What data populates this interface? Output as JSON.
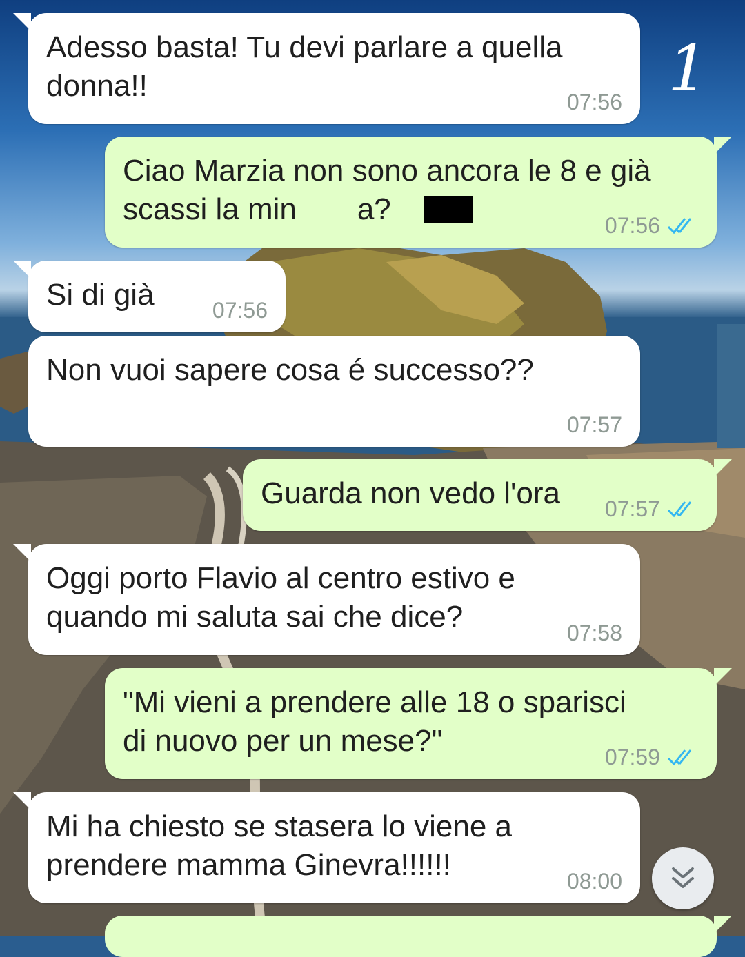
{
  "page_mark": "1",
  "messages": [
    {
      "text": "Adesso basta! Tu devi parlare a quella\ndonna!!",
      "time": "07:56",
      "direction": "incoming"
    },
    {
      "text": "Ciao Marzia non sono ancora le 8 e già\nscassi la min    a?",
      "time": "07:56",
      "direction": "outgoing",
      "status": "read"
    },
    {
      "text": "Si di già",
      "time": "07:56",
      "direction": "incoming"
    },
    {
      "text": "Non vuoi sapere cosa é successo??",
      "time": "07:57",
      "direction": "incoming"
    },
    {
      "text": "Guarda non vedo l'ora",
      "time": "07:57",
      "direction": "outgoing",
      "status": "read"
    },
    {
      "text": "Oggi porto Flavio al centro estivo e\nquando mi saluta sai che dice?",
      "time": "07:58",
      "direction": "incoming"
    },
    {
      "text": "\"Mi vieni a prendere alle 18 o sparisci\ndi nuovo per un mese?\"",
      "time": "07:59",
      "direction": "outgoing",
      "status": "read"
    },
    {
      "text": "Mi ha chiesto se stasera lo viene a\nprendere mamma Ginevra!!!!!!",
      "time": "08:00",
      "direction": "incoming"
    }
  ],
  "colors": {
    "incoming_bubble": "#ffffff",
    "outgoing_bubble": "#e2ffc8",
    "read_ticks": "#34b7f1",
    "timestamp": "#8f9a94"
  },
  "icons": {
    "scroll_down": "double-chevron-down-icon",
    "read_receipt": "double-check-icon"
  }
}
